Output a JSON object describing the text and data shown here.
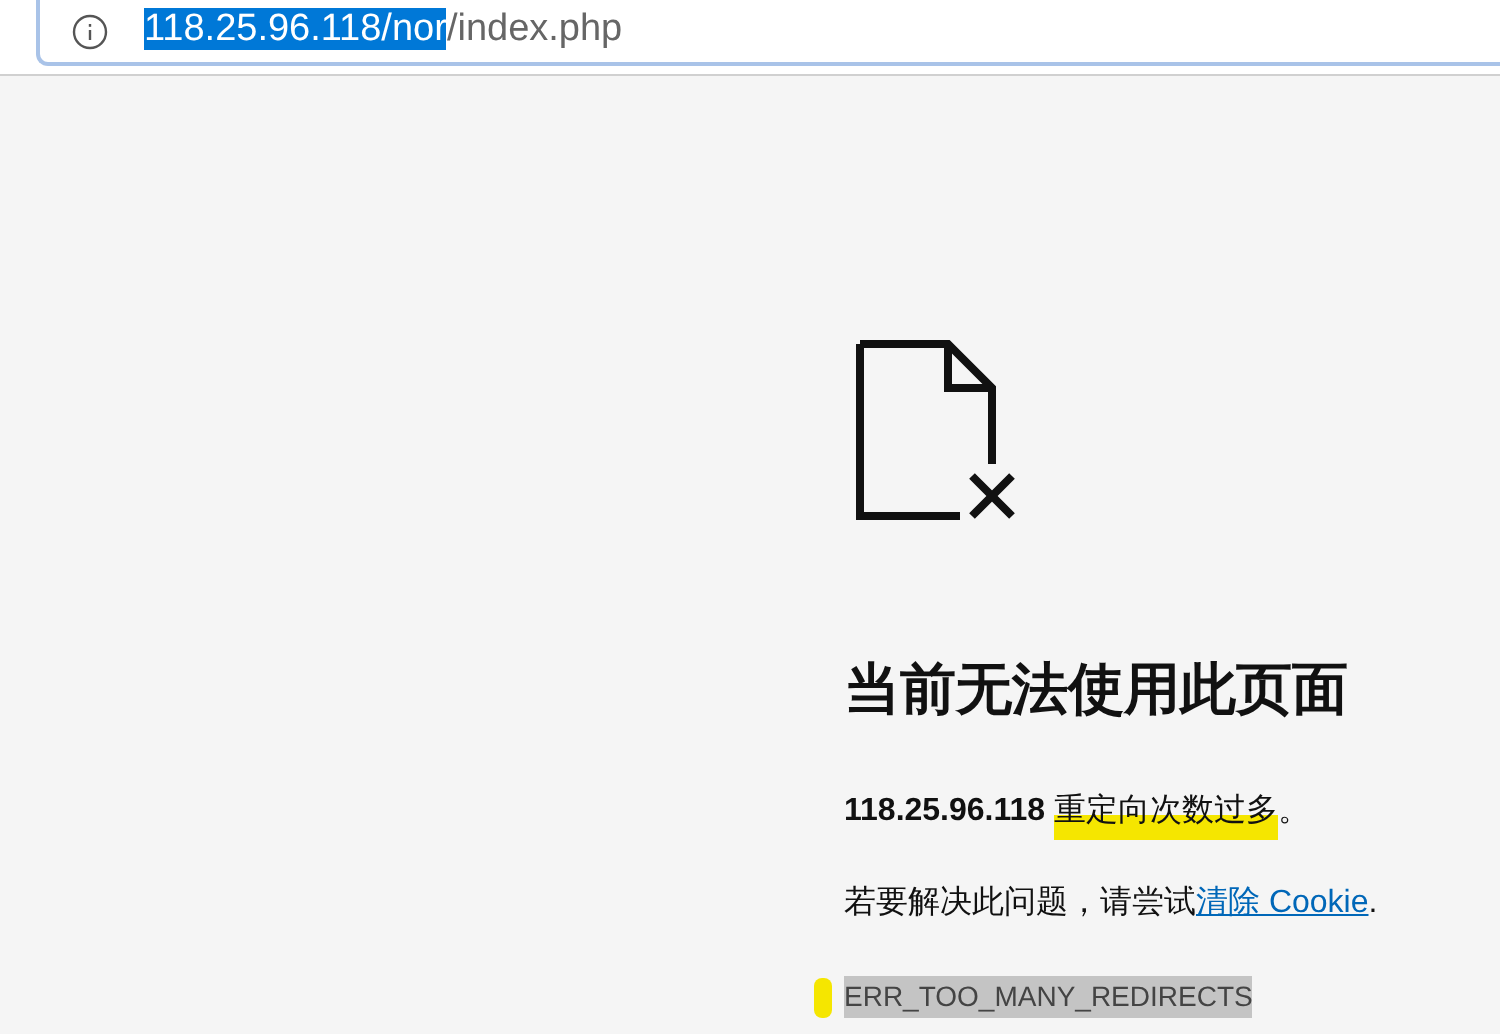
{
  "address_bar": {
    "url_selected": "118.25.96.118/nor",
    "url_rest": "/index.php"
  },
  "error": {
    "title": "当前无法使用此页面",
    "message": {
      "host": "118.25.96.118",
      "text": "重定向次数过多",
      "highlighted": true,
      "end": "。"
    },
    "hint": {
      "text": "若要解决此问题，请尝试",
      "link": "清除 Cookie",
      "end": "."
    },
    "code": {
      "text": "ERR_TOO_MANY_REDIRECTS",
      "selected": true,
      "marked": true
    }
  }
}
